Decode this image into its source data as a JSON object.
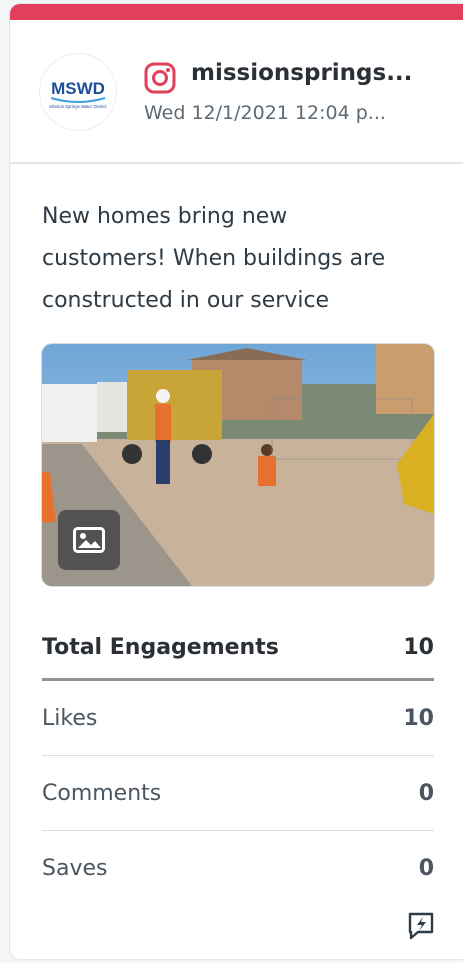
{
  "colors": {
    "accent": "#e2405a",
    "instagram": "#e2405a"
  },
  "post": {
    "account": "missionsprings...",
    "date": "Wed 12/1/2021 12:04 p...",
    "avatar_text": "MSWD",
    "avatar_subtext": "Mission Springs Water District",
    "caption": "New homes bring new customers! When buildings are constructed in our service",
    "image_badge_icon": "image-icon"
  },
  "stats": {
    "total_label": "Total Engagements",
    "total_value": "10",
    "rows": [
      {
        "label": "Likes",
        "value": "10"
      },
      {
        "label": "Comments",
        "value": "0"
      },
      {
        "label": "Saves",
        "value": "0"
      }
    ]
  },
  "footer": {
    "icon": "bolt-chat-icon"
  }
}
